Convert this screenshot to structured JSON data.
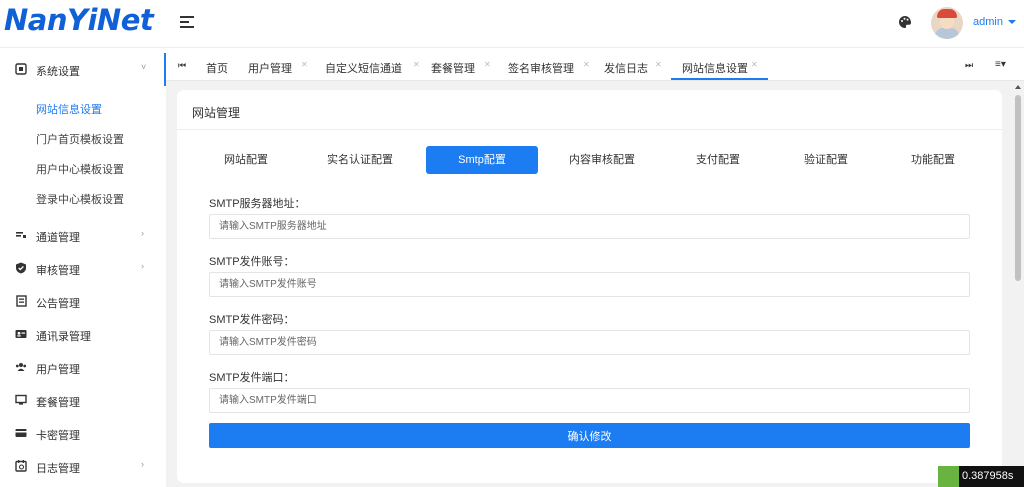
{
  "header": {
    "logo": "NanYiNet",
    "user": "admin"
  },
  "sidebar": {
    "items": [
      {
        "label": "系统设置",
        "icon": "settings-icon",
        "expandable": true
      },
      {
        "label": "通道管理",
        "icon": "channel-icon",
        "expandable": true
      },
      {
        "label": "审核管理",
        "icon": "shield-check-icon",
        "expandable": true
      },
      {
        "label": "公告管理",
        "icon": "notice-icon",
        "expandable": false
      },
      {
        "label": "通讯录管理",
        "icon": "contacts-icon",
        "expandable": false
      },
      {
        "label": "用户管理",
        "icon": "users-icon",
        "expandable": false
      },
      {
        "label": "套餐管理",
        "icon": "package-icon",
        "expandable": false
      },
      {
        "label": "卡密管理",
        "icon": "card-icon",
        "expandable": false
      },
      {
        "label": "日志管理",
        "icon": "log-icon",
        "expandable": true
      }
    ],
    "subitems": [
      {
        "label": "网站信息设置",
        "active": true
      },
      {
        "label": "门户首页模板设置",
        "active": false
      },
      {
        "label": "用户中心模板设置",
        "active": false
      },
      {
        "label": "登录中心模板设置",
        "active": false
      }
    ]
  },
  "tabs": [
    {
      "label": "首页",
      "closable": false
    },
    {
      "label": "用户管理",
      "closable": true
    },
    {
      "label": "自定义短信通道",
      "closable": true
    },
    {
      "label": "套餐管理",
      "closable": true
    },
    {
      "label": "签名审核管理",
      "closable": true
    },
    {
      "label": "发信日志",
      "closable": true
    },
    {
      "label": "网站信息设置",
      "closable": true,
      "active": true
    }
  ],
  "card": {
    "title": "网站管理",
    "config_tabs": [
      {
        "label": "网站配置"
      },
      {
        "label": "实名认证配置"
      },
      {
        "label": "Smtp配置",
        "active": true
      },
      {
        "label": "内容审核配置"
      },
      {
        "label": "支付配置"
      },
      {
        "label": "验证配置"
      },
      {
        "label": "功能配置"
      }
    ],
    "fields": [
      {
        "label": "SMTP服务器地址：",
        "placeholder": "请输入SMTP服务器地址",
        "value": ""
      },
      {
        "label": "SMTP发件账号：",
        "placeholder": "请输入SMTP发件账号",
        "value": ""
      },
      {
        "label": "SMTP发件密码：",
        "placeholder": "请输入SMTP发件密码",
        "value": ""
      },
      {
        "label": "SMTP发件端口：",
        "placeholder": "请输入SMTP发件端口",
        "value": ""
      }
    ],
    "submit": "确认修改"
  },
  "timer": "0.387958s",
  "colors": {
    "accent": "#1c7cf2",
    "logo": "#1060d8",
    "background": "#f2f2f2"
  }
}
